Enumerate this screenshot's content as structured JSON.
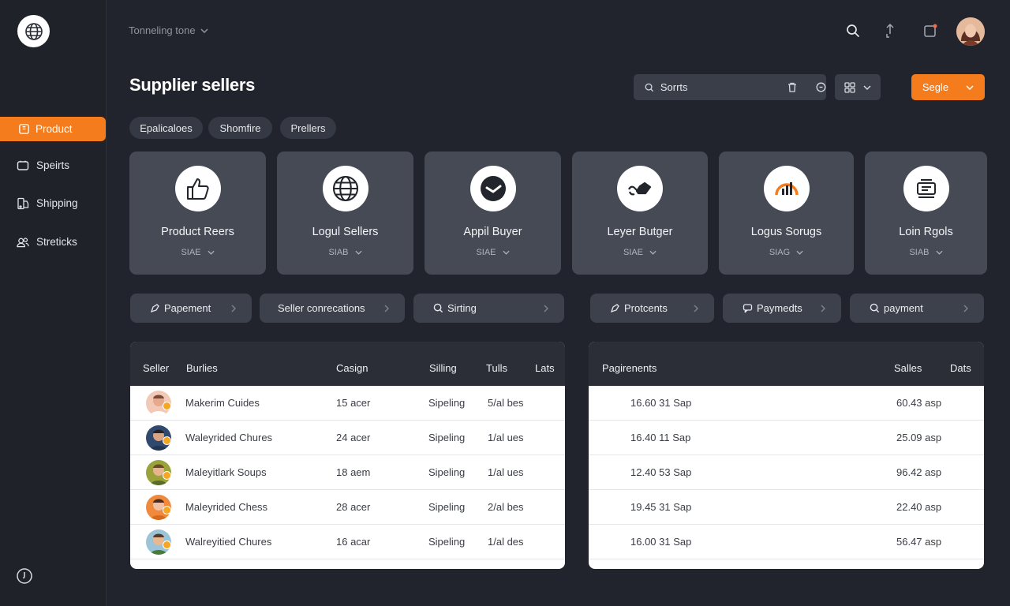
{
  "sidebar": {
    "items": [
      {
        "label": "Product",
        "icon": "package-icon",
        "active": true
      },
      {
        "label": "Speirts",
        "icon": "folder-icon",
        "active": false
      },
      {
        "label": "Shipping",
        "icon": "truck-icon",
        "active": false
      },
      {
        "label": "Streticks",
        "icon": "users-icon",
        "active": false
      }
    ]
  },
  "topbar": {
    "breadcrumb": "Tonneling tone"
  },
  "page": {
    "title": "Supplier sellers"
  },
  "search": {
    "value": "Sorrts",
    "placeholder": "Sorrts"
  },
  "primary_button": {
    "label": "Segle"
  },
  "chips": [
    "Epalicaloes",
    "Shomfire",
    "Prellers"
  ],
  "cards": [
    {
      "title": "Product Reers",
      "sub": "SIAE",
      "icon": "thumbs-up-icon"
    },
    {
      "title": "Logul Sellers",
      "sub": "SIAB",
      "icon": "globe-icon"
    },
    {
      "title": "Appil Buyer",
      "sub": "SIAE",
      "icon": "check-badge-icon"
    },
    {
      "title": "Leyer Butger",
      "sub": "SIAE",
      "icon": "handshake-icon"
    },
    {
      "title": "Logus Sorugs",
      "sub": "SIAG",
      "icon": "chart-arc-icon"
    },
    {
      "title": "Loin Rgols",
      "sub": "SIAB",
      "icon": "cash-register-icon"
    }
  ],
  "pills": [
    {
      "label": "Papement",
      "icon": "tag-icon"
    },
    {
      "label": "Seller conrecations",
      "icon": "none"
    },
    {
      "label": "Sirting",
      "icon": "search-icon"
    },
    {
      "label": "Protcents",
      "icon": "tag-icon"
    },
    {
      "label": "Paymedts",
      "icon": "message-icon"
    },
    {
      "label": "payment",
      "icon": "search-icon"
    }
  ],
  "sellers_table": {
    "headers": [
      "Seller",
      "Burlies",
      "Casign",
      "Silling",
      "Tulls",
      "Lats"
    ],
    "rows": [
      {
        "name": "Makerim Cuides",
        "casign": "15 acer",
        "silling": "Sipeling",
        "tulls": "5/al bes"
      },
      {
        "name": "Waleyrided Chures",
        "casign": "24 acer",
        "silling": "Sipeling",
        "tulls": "1/al ues"
      },
      {
        "name": "Maleyitlark Soups",
        "casign": "18 aem",
        "silling": "Sipeling",
        "tulls": "1/al ues"
      },
      {
        "name": "Maleyrided Chess",
        "casign": "28 acer",
        "silling": "Sipeling",
        "tulls": "2/al bes"
      },
      {
        "name": "Walreyitied Chures",
        "casign": "16 acar",
        "silling": "Sipeling",
        "tulls": "1/al des"
      }
    ]
  },
  "payments_table": {
    "headers": [
      "Pagirenents",
      "Salles",
      "Dats"
    ],
    "rows": [
      {
        "date": "16.60 31 Sap",
        "sales": "60.43 asp"
      },
      {
        "date": "16.40 11 Sap",
        "sales": "25.09 asp"
      },
      {
        "date": "12.40 53 Sap",
        "sales": "96.42 asp"
      },
      {
        "date": "19.45 31 Sap",
        "sales": "22.40 asp"
      },
      {
        "date": "16.00 31 Sap",
        "sales": "56.47 asp"
      }
    ]
  },
  "colors": {
    "accent": "#f57c1c",
    "background": "#21242c",
    "card": "#454a55",
    "panel": "#3a3e48"
  }
}
